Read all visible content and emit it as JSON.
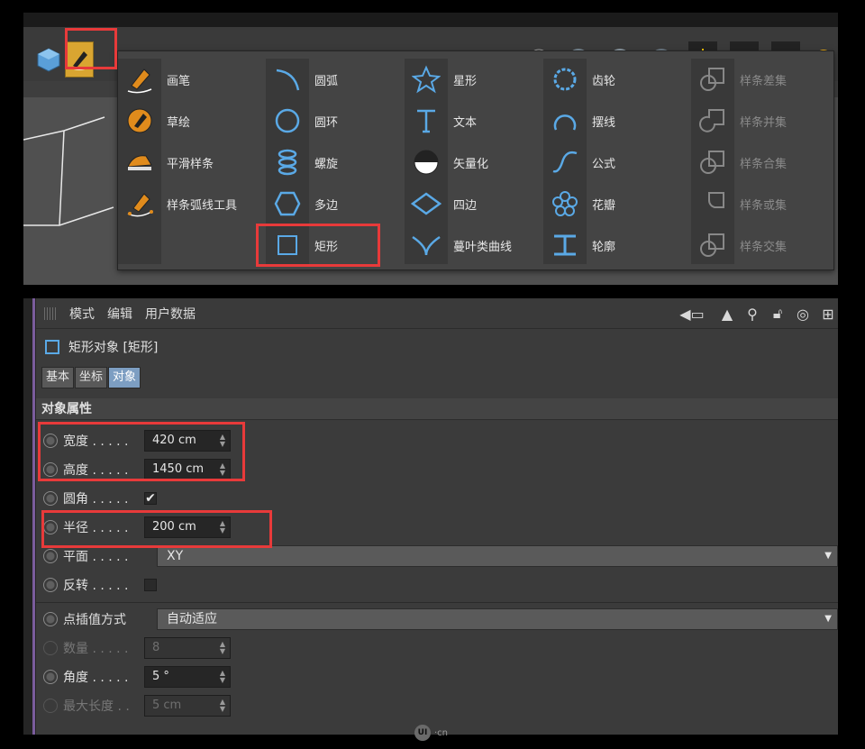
{
  "spline_menu": {
    "columns": [
      {
        "items": [
          {
            "label": "画笔",
            "icon": "pen-icon"
          },
          {
            "label": "草绘",
            "icon": "sketch-icon"
          },
          {
            "label": "平滑样条",
            "icon": "smooth-spline-icon"
          },
          {
            "label": "样条弧线工具",
            "icon": "spline-arc-tool-icon"
          }
        ]
      },
      {
        "items": [
          {
            "label": "圆弧",
            "icon": "arc-icon"
          },
          {
            "label": "圆环",
            "icon": "circle-icon"
          },
          {
            "label": "螺旋",
            "icon": "helix-icon"
          },
          {
            "label": "多边",
            "icon": "polygon-icon"
          },
          {
            "label": "矩形",
            "icon": "rectangle-icon"
          }
        ]
      },
      {
        "items": [
          {
            "label": "星形",
            "icon": "star-icon"
          },
          {
            "label": "文本",
            "icon": "text-icon"
          },
          {
            "label": "矢量化",
            "icon": "vectorize-icon"
          },
          {
            "label": "四边",
            "icon": "four-side-icon"
          },
          {
            "label": "蔓叶类曲线",
            "icon": "cissoid-icon"
          }
        ]
      },
      {
        "items": [
          {
            "label": "齿轮",
            "icon": "cog-icon"
          },
          {
            "label": "摆线",
            "icon": "cycloid-icon"
          },
          {
            "label": "公式",
            "icon": "formula-icon"
          },
          {
            "label": "花瓣",
            "icon": "flower-icon"
          },
          {
            "label": "轮廓",
            "icon": "profile-icon"
          }
        ]
      },
      {
        "items": [
          {
            "label": "样条差集",
            "icon": "spline-subtract-icon"
          },
          {
            "label": "样条并集",
            "icon": "spline-union-icon"
          },
          {
            "label": "样条合集",
            "icon": "spline-and-icon"
          },
          {
            "label": "样条或集",
            "icon": "spline-or-icon"
          },
          {
            "label": "样条交集",
            "icon": "spline-intersect-icon"
          }
        ]
      }
    ]
  },
  "attribute_manager": {
    "menus": [
      "模式",
      "编辑",
      "用户数据"
    ],
    "object_title": "矩形对象 [矩形]",
    "tabs": [
      {
        "label": "基本",
        "active": false
      },
      {
        "label": "坐标",
        "active": false
      },
      {
        "label": "对象",
        "active": true
      }
    ],
    "section_title": "对象属性",
    "props": {
      "width": {
        "label": "宽度 . . . . .",
        "value": "420 cm"
      },
      "height": {
        "label": "高度 . . . . .",
        "value": "1450 cm"
      },
      "rounding": {
        "label": "圆角 . . . . .",
        "value": "✔"
      },
      "radius": {
        "label": "半径 . . . . .",
        "value": "200 cm"
      },
      "plane": {
        "label": "平面 . . . . .",
        "value": "XY"
      },
      "reverse": {
        "label": "反转 . . . . .",
        "value": ""
      },
      "interp": {
        "label": "点插值方式",
        "value": "自动适应"
      },
      "count": {
        "label": "数量 . . . . .",
        "value": "8"
      },
      "angle": {
        "label": "角度 . . . . .",
        "value": "5 °"
      },
      "maxlen": {
        "label": "最大长度 . .",
        "value": "5 cm"
      }
    }
  },
  "watermark": {
    "text": "·cn"
  }
}
